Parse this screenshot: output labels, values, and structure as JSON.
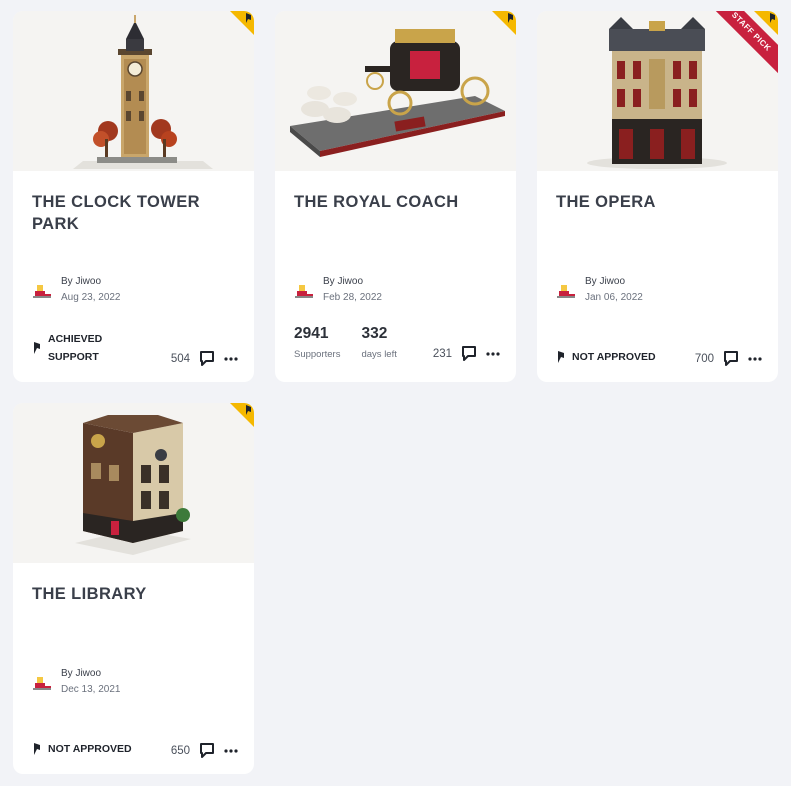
{
  "cards": [
    {
      "title": "THE CLOCK TOWER PARK",
      "author": "By Jiwoo",
      "date": "Aug 23, 2022",
      "status": "ACHIEVED SUPPORT",
      "comment_count": "504"
    },
    {
      "title": "THE ROYAL COACH",
      "author": "By Jiwoo",
      "date": "Feb 28, 2022",
      "supporters_value": "2941",
      "supporters_label": "Supporters",
      "days_value": "332",
      "days_label": "days left",
      "comment_count": "231"
    },
    {
      "title": "THE OPERA",
      "author": "By Jiwoo",
      "date": "Jan 06, 2022",
      "status": "NOT APPROVED",
      "comment_count": "700",
      "badge": "STAFF PICK"
    },
    {
      "title": "THE LIBRARY",
      "author": "By Jiwoo",
      "date": "Dec 13, 2021",
      "status": "NOT APPROVED",
      "comment_count": "650"
    }
  ],
  "colors": {
    "flag": "#f5b800",
    "staff_pick": "#c8213e",
    "background": "#f2f3f7"
  }
}
